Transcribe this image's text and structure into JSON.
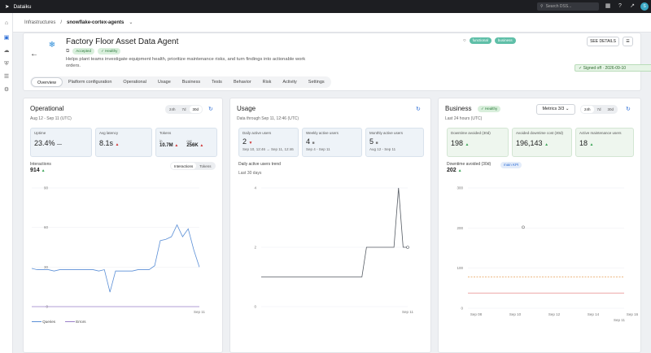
{
  "topbar": {
    "brand": "Dataiku",
    "search_placeholder": "Search DSS..."
  },
  "breadcrumb": {
    "root": "Infrastructures",
    "sep": "/",
    "current": "snowflake-cortex-agents"
  },
  "agent": {
    "title": "Factory Floor Asset Data Agent",
    "status_accepted": "Accepted",
    "status_health": "Healthy",
    "description": "Helps plant teams investigate equipment health, prioritize maintenance risks, and turn findings into actionable work orders.",
    "tags": [
      "functional",
      "business"
    ],
    "see_details": "SEE DETAILS",
    "signed_off": "Signed off · 2026-09-10"
  },
  "tabs": [
    "Overview",
    "Platform configuration",
    "Operational",
    "Usage",
    "Business",
    "Tests",
    "Behavior",
    "Risk",
    "Activity",
    "Settings"
  ],
  "operational": {
    "title": "Operational",
    "subtitle": "Aug 12 - Sep 11 (UTC)",
    "ranges": [
      "24h",
      "7d",
      "30d"
    ],
    "metrics": {
      "uptime_label": "Uptime",
      "uptime_value": "23.4%",
      "uptime_extra": "—",
      "latency_label": "Avg latency",
      "latency_value": "8.1s",
      "tokens_label": "Tokens",
      "tokens_in_label": "in",
      "tokens_in": "10.7M",
      "tokens_out_label": "out",
      "tokens_out": "256K"
    },
    "interactions_label": "Interactions",
    "interactions_value": "914",
    "toggle": [
      "Interactions",
      "Tokens"
    ],
    "legend": [
      "Queries",
      "Errors"
    ]
  },
  "usage": {
    "title": "Usage",
    "subtitle": "Data through Sep 11, 12:46 (UTC)",
    "metrics": {
      "dau_label": "Daily active users",
      "dau_value": "2",
      "dau_sub": "Sep 10, 12:46 → Sep 11, 12:46",
      "wau_label": "Weekly active users",
      "wau_value": "4",
      "wau_sub": "Sep 4 - Sep 11",
      "mau_label": "Monthly active users",
      "mau_value": "5",
      "mau_sub": "Aug 12 - Sep 11"
    },
    "trend_title": "Daily active users trend",
    "trend_sub": "Last 30 days"
  },
  "business": {
    "title": "Business",
    "health": "Healthy",
    "metrics_btn": "Metrics 3/3",
    "ranges": [
      "24h",
      "7d",
      "30d"
    ],
    "subtitle": "Last 24 hours (UTC)",
    "metrics": {
      "dt_label": "Downtime avoided (30d)",
      "dt_value": "198",
      "cost_label": "Avoided downtime cost (30d)",
      "cost_value": "196,143",
      "maint_label": "Active maintenance users",
      "maint_value": "18"
    },
    "chart_label": "Downtime avoided (30d)",
    "chart_value": "202",
    "chart_badge": "main KPI"
  },
  "colors": {
    "accent": "#2f6fd6",
    "green": "#3fa65a",
    "red": "#d03a3a",
    "line": "#5b8fd6"
  },
  "chart_data": [
    {
      "type": "line",
      "title": "Interactions",
      "x": [
        "Aug 12",
        "",
        "",
        "",
        "",
        "",
        "",
        "",
        "",
        "",
        "",
        "",
        "",
        "",
        "",
        "",
        "",
        "",
        "",
        "",
        "",
        "",
        "",
        "",
        "",
        "",
        "",
        "",
        "",
        "",
        "Sep 11"
      ],
      "ylim": [
        0,
        90
      ],
      "series": [
        {
          "name": "Queries",
          "values": [
            29,
            28,
            28,
            28,
            27,
            28,
            28,
            28,
            28,
            28,
            28,
            28,
            27,
            28,
            11,
            27,
            27,
            27,
            27,
            28,
            28,
            28,
            31,
            50,
            51,
            53,
            62,
            53,
            59,
            43,
            30
          ]
        },
        {
          "name": "Errors",
          "values": [
            0,
            0,
            0,
            0,
            0,
            0,
            0,
            0,
            0,
            0,
            0,
            0,
            0,
            0,
            0,
            0,
            0,
            0,
            0,
            0,
            0,
            0,
            0,
            0,
            0,
            0,
            0,
            0,
            0,
            0,
            0
          ]
        }
      ],
      "ticks_y": [
        "90",
        "60",
        "30",
        "0"
      ],
      "ticks_x": [
        "Sep 11"
      ]
    },
    {
      "type": "line",
      "title": "Daily active users trend",
      "x": [
        "",
        "",
        "",
        "",
        "",
        "",
        "",
        "",
        "",
        "",
        "",
        "",
        "",
        "",
        "",
        "",
        "",
        "",
        "",
        "",
        "",
        "",
        "",
        "",
        "",
        "",
        "",
        "",
        "",
        "Sep 11"
      ],
      "ylim": [
        0,
        4
      ],
      "series": [
        {
          "values": [
            1,
            1,
            1,
            1,
            1,
            1,
            1,
            1,
            1,
            1,
            1,
            1,
            1,
            1,
            1,
            1,
            1,
            1,
            1,
            1,
            1,
            1,
            1,
            2,
            2,
            2,
            2,
            2,
            2,
            2,
            4,
            2,
            2
          ]
        }
      ],
      "ticks_y": [
        "4",
        "2",
        "0"
      ],
      "ticks_x": [
        "Sep 11"
      ]
    },
    {
      "type": "scatter",
      "title": "Downtime avoided (30d)",
      "ylim": [
        0,
        300
      ],
      "series": [
        {
          "values": [
            202
          ]
        }
      ],
      "ticks_y": [
        "300",
        "200",
        "100",
        "0"
      ],
      "ticks_x": [
        "Sep 08",
        "Sep 10",
        "Sep 12",
        "Sep 14",
        "Sep 16",
        "Sep 11"
      ]
    }
  ]
}
